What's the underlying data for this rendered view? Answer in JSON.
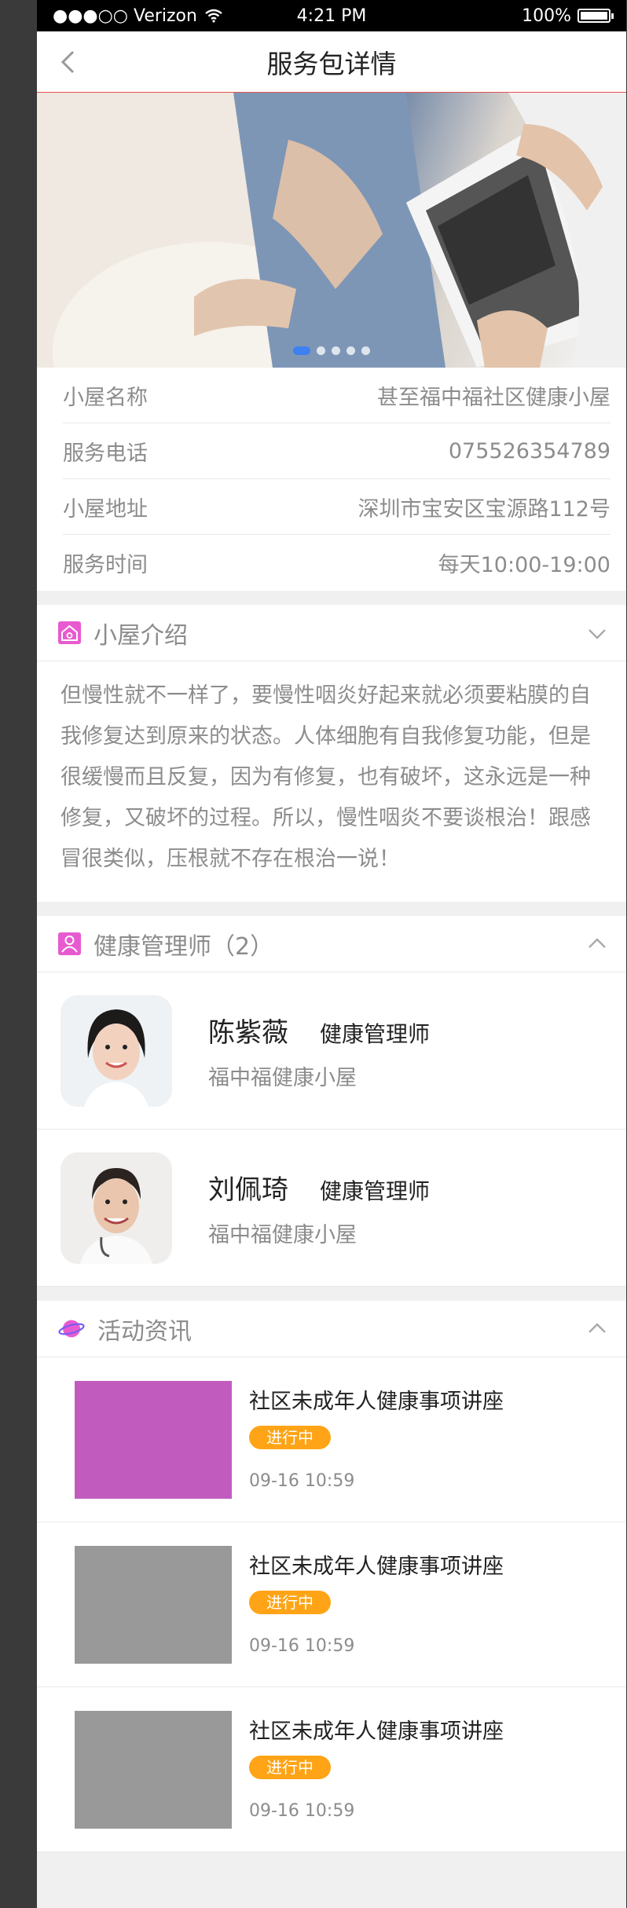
{
  "status": {
    "carrier": "●●●○○ Verizon",
    "time": "4:21 PM",
    "battery": "100%"
  },
  "nav": {
    "title": "服务包详情"
  },
  "banner": {
    "slides": 5,
    "active_index": 0
  },
  "info": [
    {
      "label": "小屋名称",
      "value": "甚至福中福社区健康小屋"
    },
    {
      "label": "服务电话",
      "value": "075526354789"
    },
    {
      "label": "小屋地址",
      "value": "深圳市宝安区宝源路112号"
    },
    {
      "label": "服务时间",
      "value": "每天10:00-19:00"
    }
  ],
  "intro": {
    "title": "小屋介绍",
    "text": "但慢性就不一样了，要慢性咽炎好起来就必须要粘膜的自我修复达到原来的状态。人体细胞有自我修复功能，但是很缓慢而且反复，因为有修复，也有破坏，这永远是一种修复，又破坏的过程。所以，慢性咽炎不要谈根治！跟感冒很类似，压根就不存在根治一说！"
  },
  "managers": {
    "title": "健康管理师（2）",
    "items": [
      {
        "name": "陈紫薇",
        "role": "健康管理师",
        "place": "福中福健康小屋"
      },
      {
        "name": "刘佩琦",
        "role": "健康管理师",
        "place": "福中福健康小屋"
      }
    ]
  },
  "activities": {
    "title": "活动资讯",
    "items": [
      {
        "title": "社区未成年人健康事项讲座",
        "badge": "进行中",
        "date": "09-16  10:59"
      },
      {
        "title": "社区未成年人健康事项讲座",
        "badge": "进行中",
        "date": "09-16  10:59"
      },
      {
        "title": "社区未成年人健康事项讲座",
        "badge": "进行中",
        "date": "09-16  10:59"
      }
    ]
  },
  "colors": {
    "accent": "#ffa416",
    "badge_text": "#ffffff",
    "dot_active": "#3d80f0",
    "icon_pink": "#e85ad0",
    "thumb_first": "#c15cbe",
    "thumb_placeholder": "#999999"
  }
}
